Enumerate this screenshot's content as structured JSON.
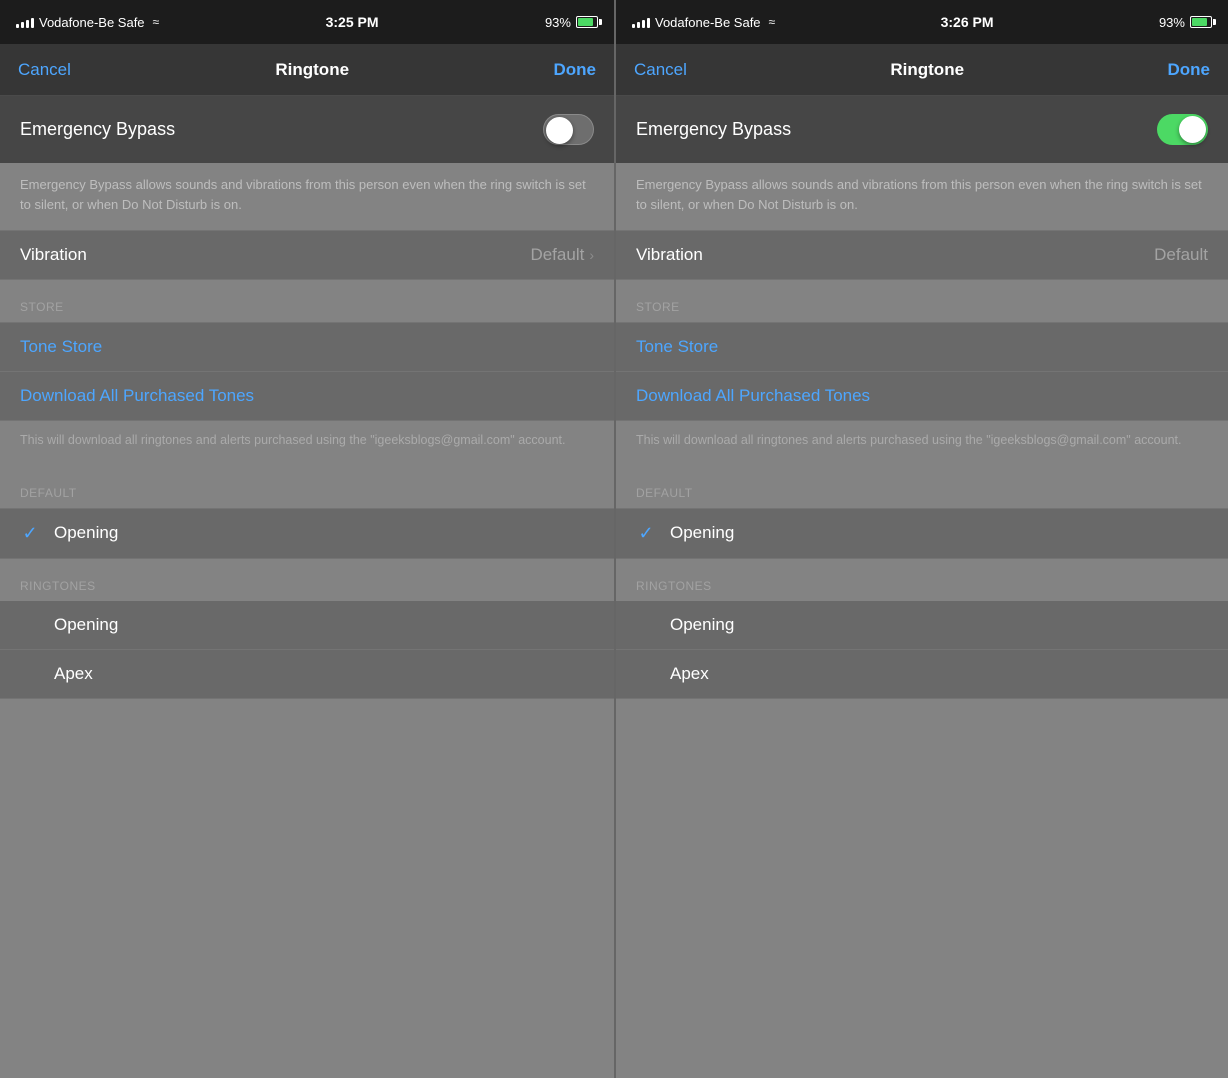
{
  "panels": [
    {
      "id": "panel-left",
      "statusBar": {
        "carrier": "Vodafone-Be Safe",
        "time": "3:25 PM",
        "battery": "93%"
      },
      "navBar": {
        "cancel": "Cancel",
        "title": "Ringtone",
        "done": "Done"
      },
      "emergencyBypass": {
        "label": "Emergency Bypass",
        "toggleState": "off"
      },
      "description": "Emergency Bypass allows sounds and vibrations from this person even when the ring switch is set to silent, or when Do Not Disturb is on.",
      "vibration": {
        "label": "Vibration",
        "value": "Default"
      },
      "storeSectionLabel": "STORE",
      "toneStore": "Tone Store",
      "downloadAll": "Download All Purchased Tones",
      "downloadNote": "This will download all ringtones and alerts purchased using the \"igeeksblogs@gmail.com\" account.",
      "defaultSectionLabel": "DEFAULT",
      "defaultItem": "Opening",
      "ringtonesSectionLabel": "RINGTONES",
      "ringtoneItems": [
        "Opening",
        "Apex"
      ]
    },
    {
      "id": "panel-right",
      "statusBar": {
        "carrier": "Vodafone-Be Safe",
        "time": "3:26 PM",
        "battery": "93%"
      },
      "navBar": {
        "cancel": "Cancel",
        "title": "Ringtone",
        "done": "Done"
      },
      "emergencyBypass": {
        "label": "Emergency Bypass",
        "toggleState": "on"
      },
      "description": "Emergency Bypass allows sounds and vibrations from this person even when the ring switch is set to silent, or when Do Not Disturb is on.",
      "vibration": {
        "label": "Vibration",
        "value": "Default"
      },
      "storeSectionLabel": "STORE",
      "toneStore": "Tone Store",
      "downloadAll": "Download All Purchased Tones",
      "downloadNote": "This will download all ringtones and alerts purchased using the \"igeeksblogs@gmail.com\" account.",
      "defaultSectionLabel": "DEFAULT",
      "defaultItem": "Opening",
      "ringtonesSectionLabel": "RINGTONES",
      "ringtoneItems": [
        "Opening",
        "Apex"
      ]
    }
  ]
}
